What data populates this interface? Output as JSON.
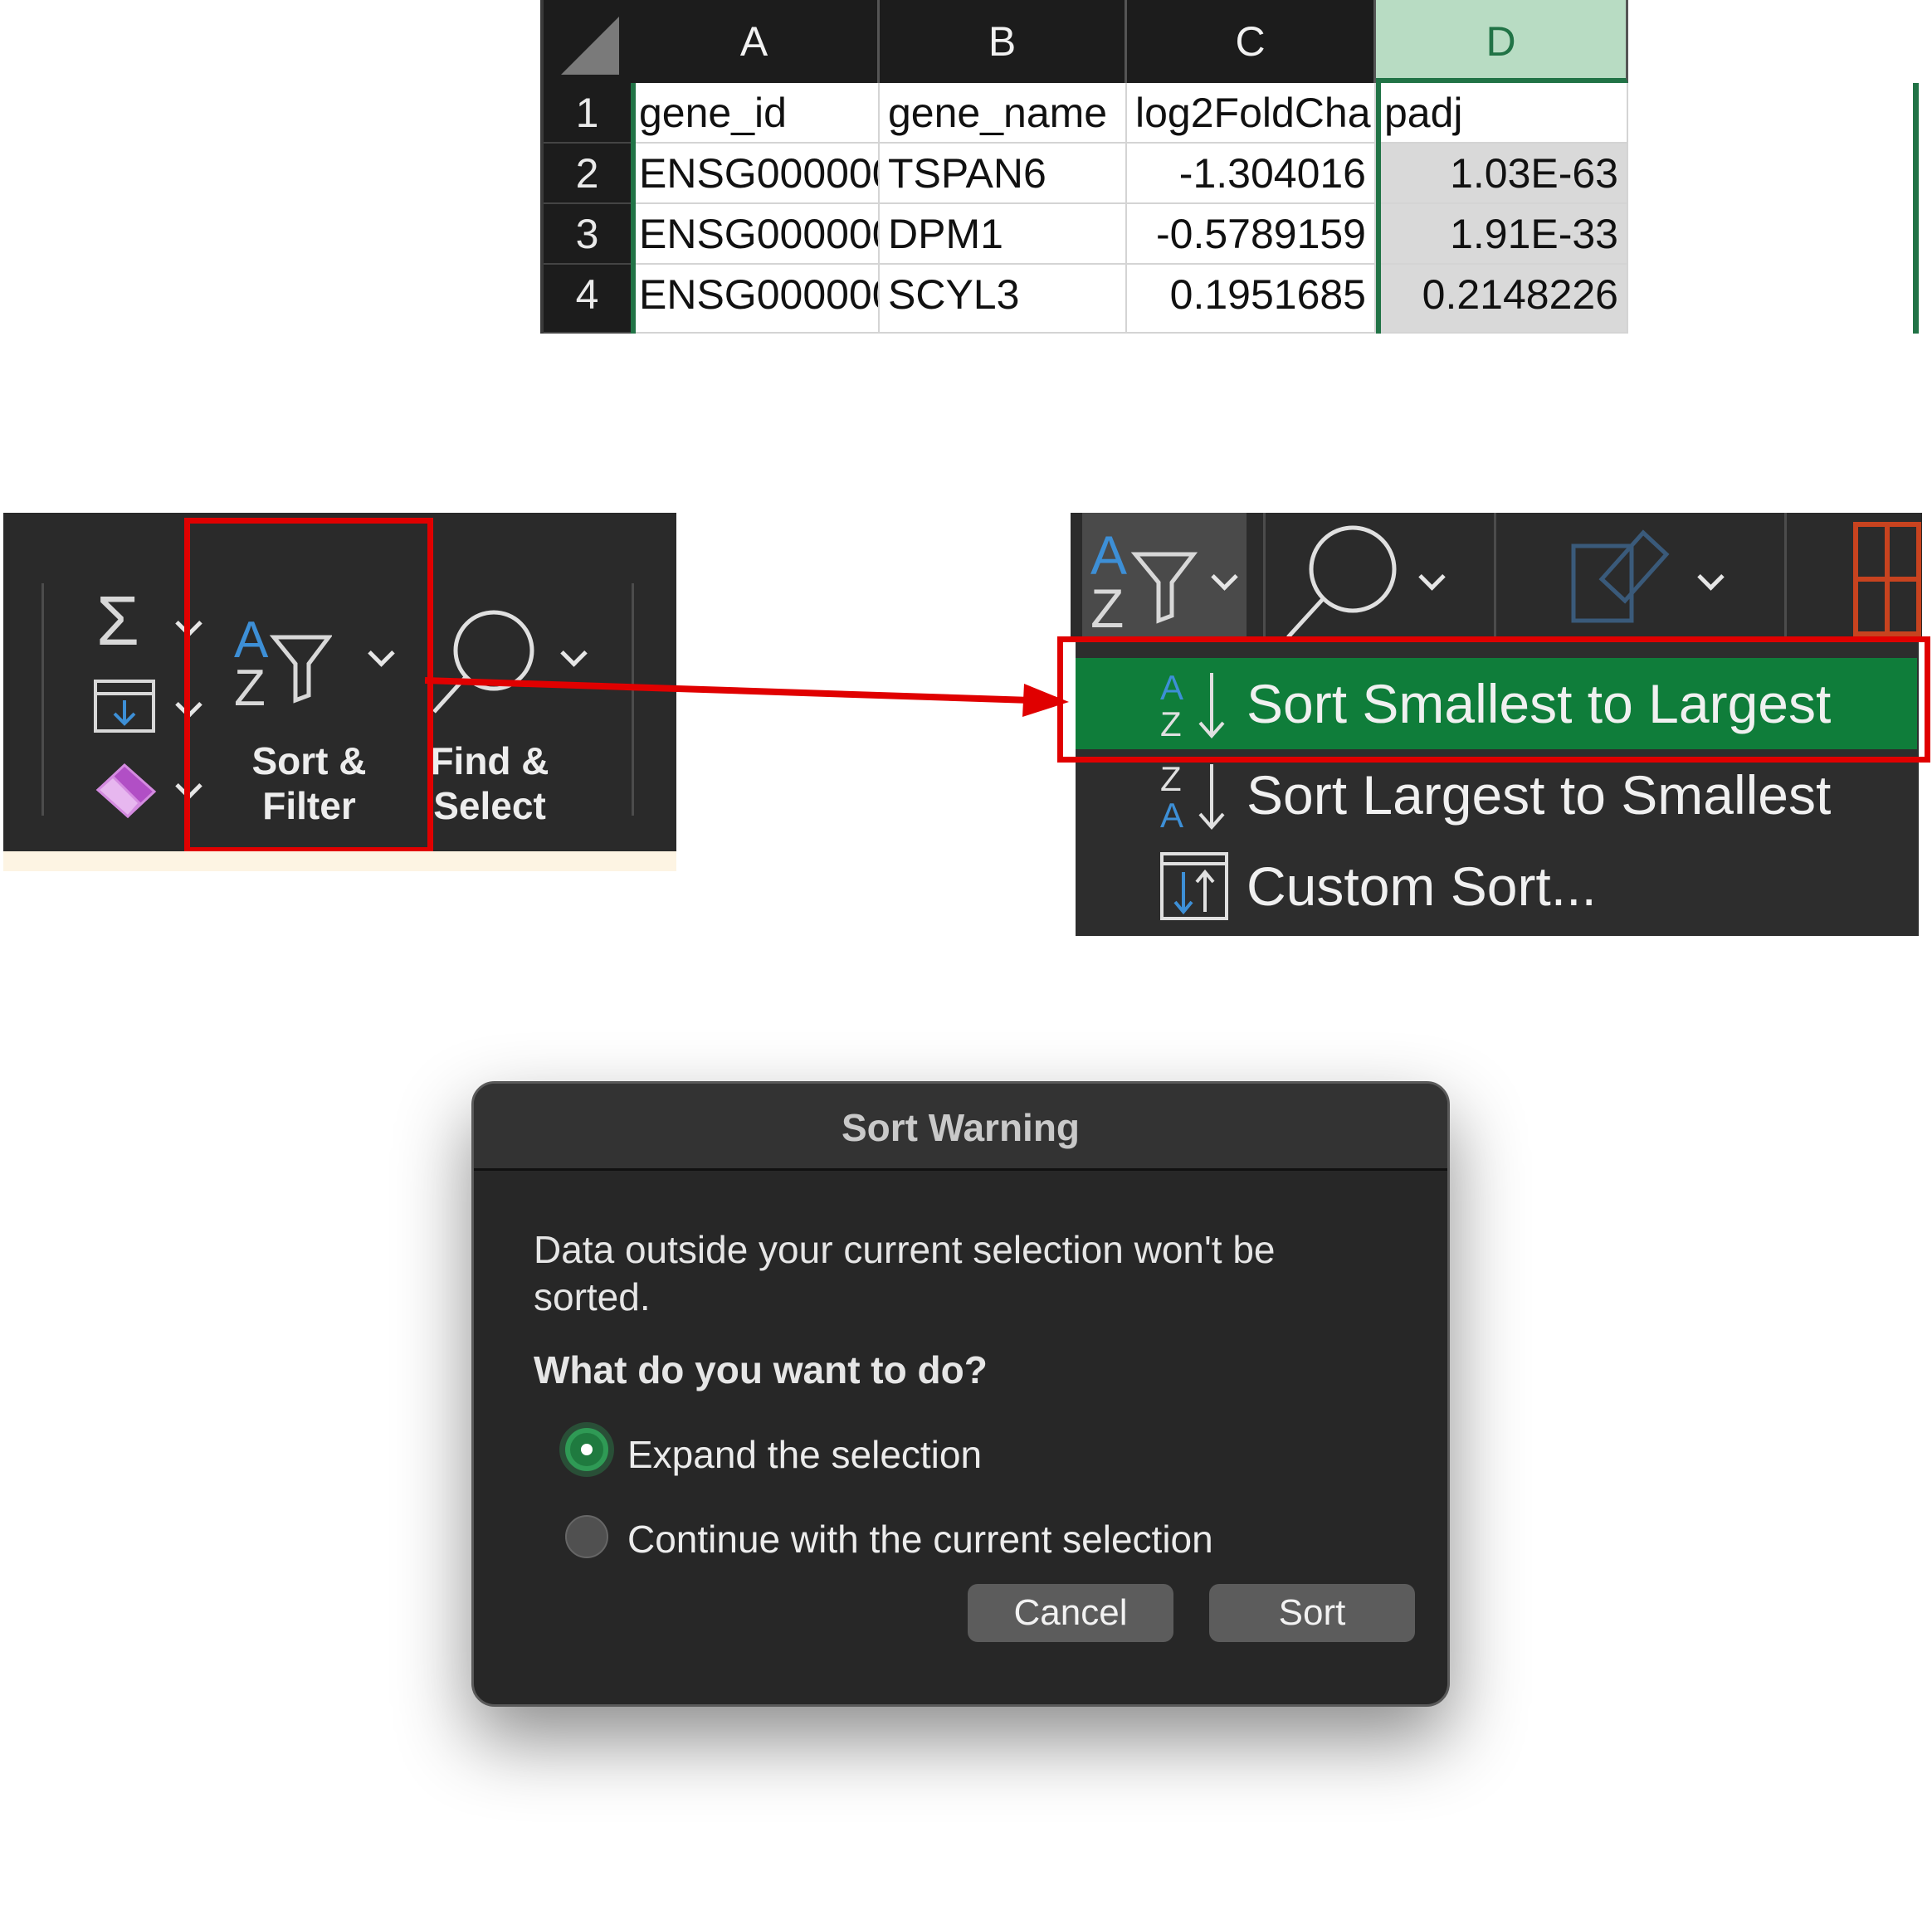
{
  "spreadsheet": {
    "columns": [
      "A",
      "B",
      "C",
      "D"
    ],
    "rows": [
      "1",
      "2",
      "3",
      "4"
    ],
    "selected_column": "D",
    "header_row": [
      "gene_id",
      "gene_name",
      "log2FoldCha",
      "padj"
    ],
    "data": [
      [
        "ENSG000000",
        "TSPAN6",
        "-1.304016",
        "1.03E-63"
      ],
      [
        "ENSG000000",
        "DPM1",
        "-0.5789159",
        "1.91E-33"
      ],
      [
        "ENSG000000",
        "SCYL3",
        "0.1951685",
        "0.2148226"
      ]
    ]
  },
  "ribbon": {
    "sort_filter_label_1": "Sort &",
    "sort_filter_label_2": "Filter",
    "find_select_label_1": "Find &",
    "find_select_label_2": "Select",
    "icons": [
      "sum-icon",
      "fill-icon",
      "eraser-icon",
      "sort-filter-icon",
      "find-icon"
    ]
  },
  "dropdown": {
    "items": [
      {
        "label": "Sort Smallest to Largest",
        "active": true
      },
      {
        "label": "Sort Largest to Smallest",
        "active": false
      },
      {
        "label": "Custom Sort...",
        "active": false
      }
    ]
  },
  "dialog": {
    "title": "Sort Warning",
    "message": "Data outside your current selection won't be sorted.",
    "question": "What do you want to do?",
    "options": [
      {
        "label": "Expand the selection",
        "selected": true
      },
      {
        "label": "Continue with the current selection",
        "selected": false
      }
    ],
    "cancel_label": "Cancel",
    "sort_label": "Sort"
  },
  "colors": {
    "excel_green": "#217346",
    "menu_active": "#0f7d3a",
    "highlight_red": "#e00000",
    "icon_blue": "#3d8fd6"
  }
}
